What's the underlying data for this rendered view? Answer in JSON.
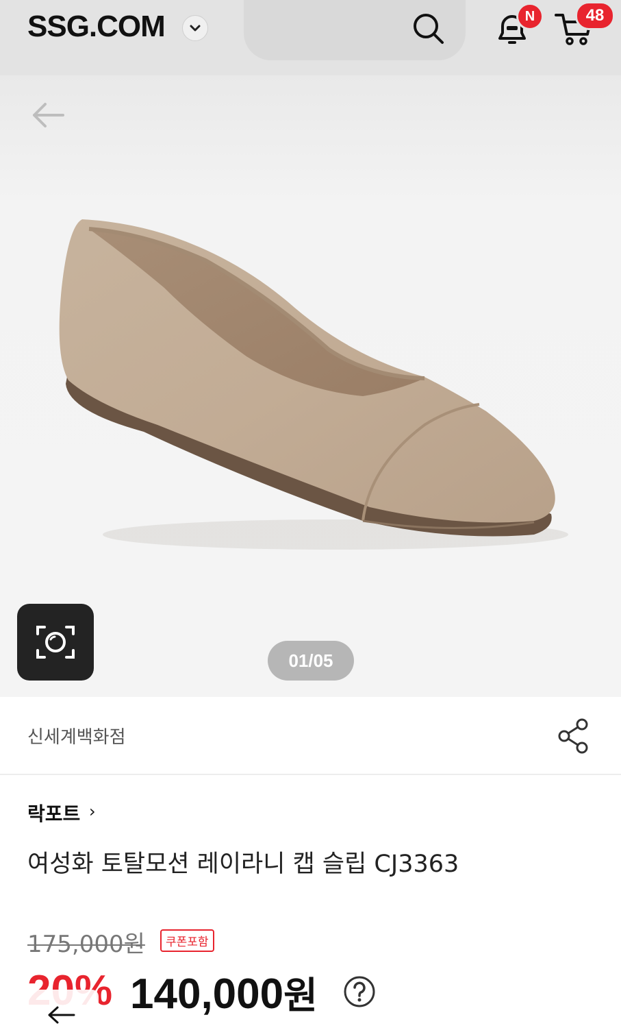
{
  "header": {
    "logo": "SSG.COM",
    "notification_badge": "N",
    "cart_count": "48",
    "accent_color": "#e8242e"
  },
  "gallery": {
    "counter": "01/05",
    "icons": [
      "back-arrow-icon",
      "camera-scan-icon"
    ]
  },
  "seller": {
    "name": "신세계백화점",
    "share_icon": "share-icon"
  },
  "product": {
    "brand": "락포트",
    "brand_chevron": "›",
    "title": "여성화 토탈모션 레이라니 캡 슬립 CJ3363",
    "original_price": "175,000원",
    "coupon_label": "쿠폰포함",
    "discount": "20%",
    "sale_price": "140,000",
    "sale_unit": "원"
  }
}
